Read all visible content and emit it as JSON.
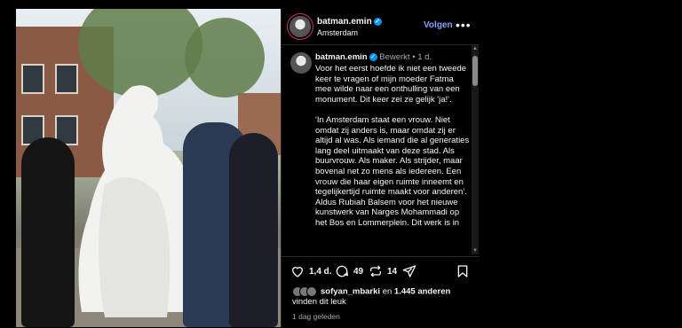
{
  "post": {
    "author": "batman.emin",
    "location": "Amsterdam",
    "follow_label": "Volgen",
    "more_label": "•••",
    "edited_label": "Bewerkt",
    "separator": "•",
    "age": "1 d.",
    "caption": "Voor het eerst hoefde ik niet een tweede keer te vragen of mijn moeder Fatma mee wilde naar een onthulling van een monument. Dit keer zei ze gelijk 'ja!'.\n\n'In Amsterdam staat een vrouw. Niet omdat zij anders is, maar omdat zij er altijd al was. Als iemand die al generaties lang deel uitmaakt van deze stad. Als buurvrouw. Als maker. Als strijder, maar bovenal net zo mens als iedereen. Een vrouw die haar eigen ruimte inneemt en tegelijkertijd ruimte maakt voor anderen'. Aldus Rubiah Balsem voor het nieuwe kunstwerk van Narges Mohammadi op het Bos en Lommerplein. Dit werk is in",
    "likes_count": "1,4 d.",
    "comments_count": "49",
    "reposts_count": "14",
    "liked_by_user": "sofyan_mbarki",
    "liked_by_middle": " en ",
    "liked_by_others": "1.445 anderen",
    "liked_by_suffix": " vinden dit leuk",
    "date": "1 dag geleden"
  },
  "icons": [
    "heart-icon",
    "comment-icon",
    "repost-icon",
    "share-icon",
    "bookmark-icon",
    "verified-icon"
  ],
  "colors": {
    "background": "#000000",
    "accent_link": "#85a1ff",
    "verified": "#0095f6",
    "muted": "#a8a8a8"
  }
}
